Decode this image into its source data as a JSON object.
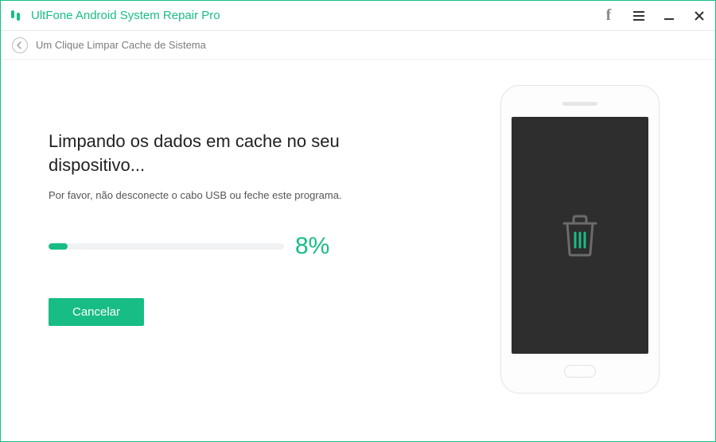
{
  "titlebar": {
    "app_title": "UltFone Android System Repair Pro"
  },
  "subheader": {
    "breadcrumb": "Um Clique Limpar Cache de Sistema"
  },
  "main": {
    "heading": "Limpando os dados em cache no seu dispositivo...",
    "subtext": "Por favor, não desconecte o cabo USB ou feche este programa.",
    "progress_percent": 8,
    "progress_label": "8%",
    "cancel_label": "Cancelar"
  },
  "colors": {
    "accent": "#18bd85",
    "screen": "#2e2e2e"
  }
}
